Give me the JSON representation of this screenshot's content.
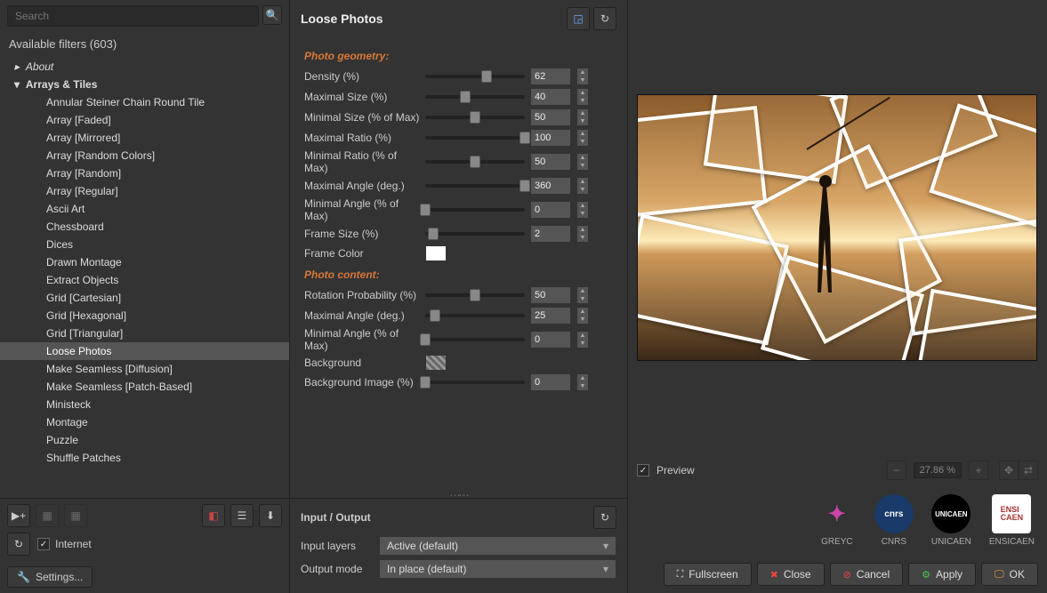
{
  "search": {
    "placeholder": "Search"
  },
  "filters_header": "Available filters (603)",
  "tree": {
    "about": "About",
    "category": "Arrays & Tiles",
    "items": [
      "Annular Steiner Chain Round Tile",
      "Array [Faded]",
      "Array [Mirrored]",
      "Array [Random Colors]",
      "Array [Random]",
      "Array [Regular]",
      "Ascii Art",
      "Chessboard",
      "Dices",
      "Drawn Montage",
      "Extract Objects",
      "Grid [Cartesian]",
      "Grid [Hexagonal]",
      "Grid [Triangular]",
      "Loose Photos",
      "Make Seamless [Diffusion]",
      "Make Seamless [Patch-Based]",
      "Ministeck",
      "Montage",
      "Puzzle",
      "Shuffle Patches"
    ],
    "selected": "Loose Photos"
  },
  "internet_label": "Internet",
  "settings_label": "Settings...",
  "filter_title": "Loose Photos",
  "sections": {
    "geometry": "Photo geometry:",
    "content": "Photo content:"
  },
  "params": {
    "geometry": [
      {
        "label": "Density (%)",
        "value": "62",
        "pct": 62
      },
      {
        "label": "Maximal Size (%)",
        "value": "40",
        "pct": 40
      },
      {
        "label": "Minimal Size (% of Max)",
        "value": "50",
        "pct": 50
      },
      {
        "label": "Maximal Ratio (%)",
        "value": "100",
        "pct": 100
      },
      {
        "label": "Minimal Ratio (% of Max)",
        "value": "50",
        "pct": 50
      },
      {
        "label": "Maximal Angle (deg.)",
        "value": "360",
        "pct": 100
      },
      {
        "label": "Minimal Angle (% of Max)",
        "value": "0",
        "pct": 0
      },
      {
        "label": "Frame Size (%)",
        "value": "2",
        "pct": 8
      }
    ],
    "frame_color_label": "Frame Color",
    "content": [
      {
        "label": "Rotation Probability (%)",
        "value": "50",
        "pct": 50
      },
      {
        "label": "Maximal Angle (deg.)",
        "value": "25",
        "pct": 10
      },
      {
        "label": "Minimal Angle (% of Max)",
        "value": "0",
        "pct": 0
      }
    ],
    "background_label": "Background",
    "bg_image": {
      "label": "Background Image (%)",
      "value": "0",
      "pct": 0
    }
  },
  "io": {
    "title": "Input / Output",
    "layers_label": "Input layers",
    "layers_value": "Active (default)",
    "output_label": "Output mode",
    "output_value": "In place (default)"
  },
  "preview_label": "Preview",
  "zoom": "27.86 %",
  "logos": [
    "GREYC",
    "CNRS",
    "UNICAEN",
    "ENSICAEN"
  ],
  "buttons": {
    "fullscreen": "Fullscreen",
    "close": "Close",
    "cancel": "Cancel",
    "apply": "Apply",
    "ok": "OK"
  }
}
